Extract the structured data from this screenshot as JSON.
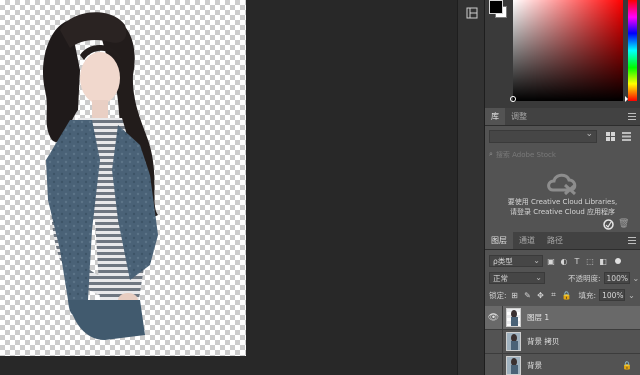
{
  "colors": {
    "workspace": "#282828",
    "panel": "#535353",
    "selected_layer": "#696969",
    "foreground": "#000000",
    "background": "#ffffff"
  },
  "icons": {
    "strip_1": "libraries-icon",
    "canvas_strip_2": "adjust-icon"
  },
  "library": {
    "tabs": [
      "库",
      "调整"
    ],
    "search_placeholder": "搜索 Adobe Stock",
    "message_line1": "要使用 Creative Cloud Libraries,",
    "message_line2": "请登录 Creative Cloud 应用程序"
  },
  "layers": {
    "tabs": [
      "图层",
      "通道",
      "路径"
    ],
    "filter_label": "ρ类型",
    "blend_mode": "正常",
    "opacity_label": "不透明度:",
    "opacity_value": "100%",
    "lock_label": "锁定:",
    "fill_label": "填充:",
    "fill_value": "100%",
    "items": [
      {
        "name": "图层 1",
        "visible": true,
        "selected": true
      },
      {
        "name": "背景 拷贝",
        "visible": false,
        "selected": false
      },
      {
        "name": "背景",
        "visible": false,
        "selected": false
      }
    ]
  }
}
